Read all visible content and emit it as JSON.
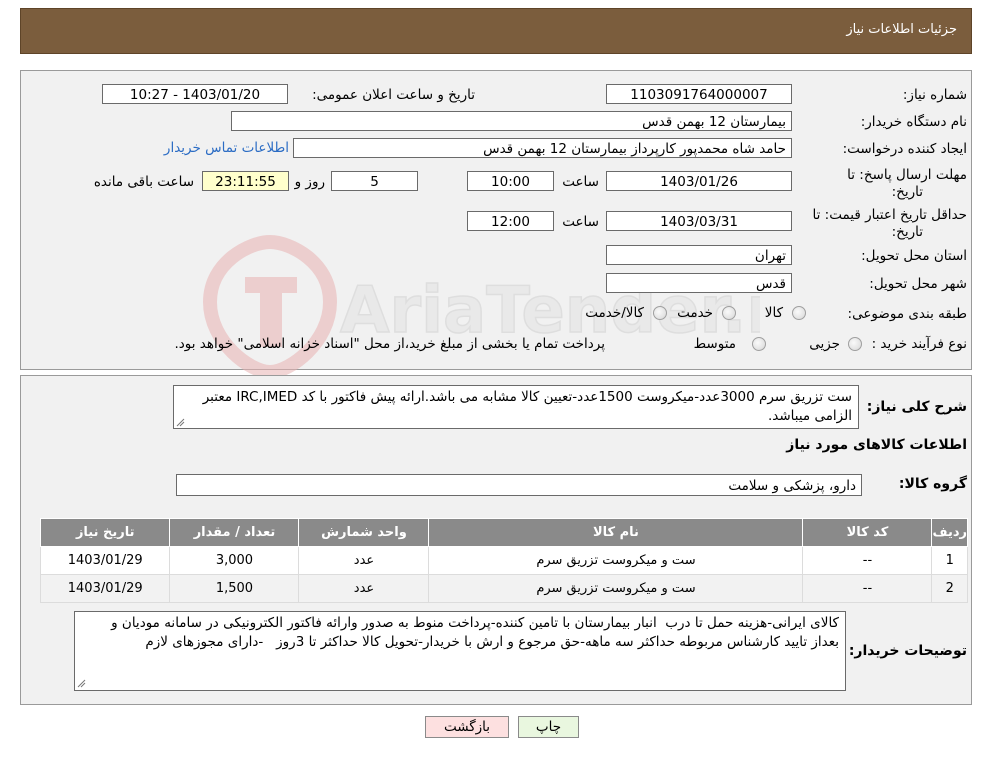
{
  "header": {
    "title": "جزئیات اطلاعات نیاز"
  },
  "form": {
    "need_number_label": "شماره نیاز:",
    "need_number": "1103091764000007",
    "announce_label": "تاریخ و ساعت اعلان عمومی:",
    "announce_value": "1403/01/20 - 10:27",
    "buyer_org_label": "نام دستگاه خریدار:",
    "buyer_org": "بیمارستان 12 بهمن قدس",
    "creator_label": "ایجاد کننده درخواست:",
    "creator": "حامد شاه محمدپور کارپرداز بیمارستان 12 بهمن قدس",
    "contact_link": "اطلاعات تماس خریدار",
    "deadline_label_1": "مهلت ارسال پاسخ: تا",
    "deadline_label_2": "تاریخ:",
    "deadline_date": "1403/01/26",
    "hour_label": "ساعت",
    "deadline_time": "10:00",
    "days_value": "5",
    "days_label": "روز و",
    "remaining_time": "23:11:55",
    "remaining_label": "ساعت باقی مانده",
    "validity_label_1": "حداقل تاریخ اعتبار قیمت: تا",
    "validity_label_2": "تاریخ:",
    "validity_date": "1403/03/31",
    "validity_hour_label": "ساعت",
    "validity_time": "12:00",
    "province_label": "استان محل تحویل:",
    "province": "تهران",
    "city_label": "شهر محل تحویل:",
    "city": "قدس",
    "category_label": "طبقه بندی موضوعی:",
    "category_options": [
      "کالا",
      "خدمت",
      "کالا/خدمت"
    ],
    "process_label": "نوع فرآیند خرید :",
    "process_options": [
      "جزیی",
      "متوسط"
    ],
    "process_note": "پرداخت تمام یا بخشی از مبلغ خرید،از محل \"اسناد خزانه اسلامی\" خواهد بود."
  },
  "watermark": {
    "text": "AriaTender.neT",
    "color": "#e9b3b3"
  },
  "details": {
    "summary_label": "شرح کلی نیاز:",
    "summary_text": "ست تزریق سرم 3000عدد-میکروست 1500عدد-تعیین کالا مشابه می باشد.ارائه پیش فاکتور با کد IRC,IMED معتبر الزامی میباشد.",
    "goods_info_title": "اطلاعات کالاهای مورد نیاز",
    "goods_group_label": "گروه کالا:",
    "goods_group": "دارو، پزشکی و سلامت",
    "table": {
      "headers": [
        "ردیف",
        "کد کالا",
        "نام کالا",
        "واحد شمارش",
        "تعداد / مقدار",
        "تاریخ نیاز"
      ],
      "rows": [
        [
          "1",
          "--",
          "ست و میکروست تزریق سرم",
          "عدد",
          "3,000",
          "1403/01/29"
        ],
        [
          "2",
          "--",
          "ست و میکروست تزریق سرم",
          "عدد",
          "1,500",
          "1403/01/29"
        ]
      ]
    },
    "buyer_notes_label": "توضیحات خریدار:",
    "buyer_notes": "کالای ایرانی-هزینه حمل تا درب  انبار بیمارستان با تامین کننده-پرداخت منوط به صدور وارائه فاکتور الکترونیکی در سامانه مودیان و بعداز تایید کارشناس مربوطه حداکثر سه ماهه-حق مرجوع و ارش با خریدار-تحویل کالا حداکثر تا 3روز   -دارای مجوزهای لازم"
  },
  "buttons": {
    "print": "چاپ",
    "back": "بازگشت"
  },
  "colors": {
    "header": "#7b5d3d",
    "table_header": "#8a8a8a",
    "back_button": "#fde0e0",
    "print_button": "#e9f7df",
    "link": "#2b6cc4"
  }
}
